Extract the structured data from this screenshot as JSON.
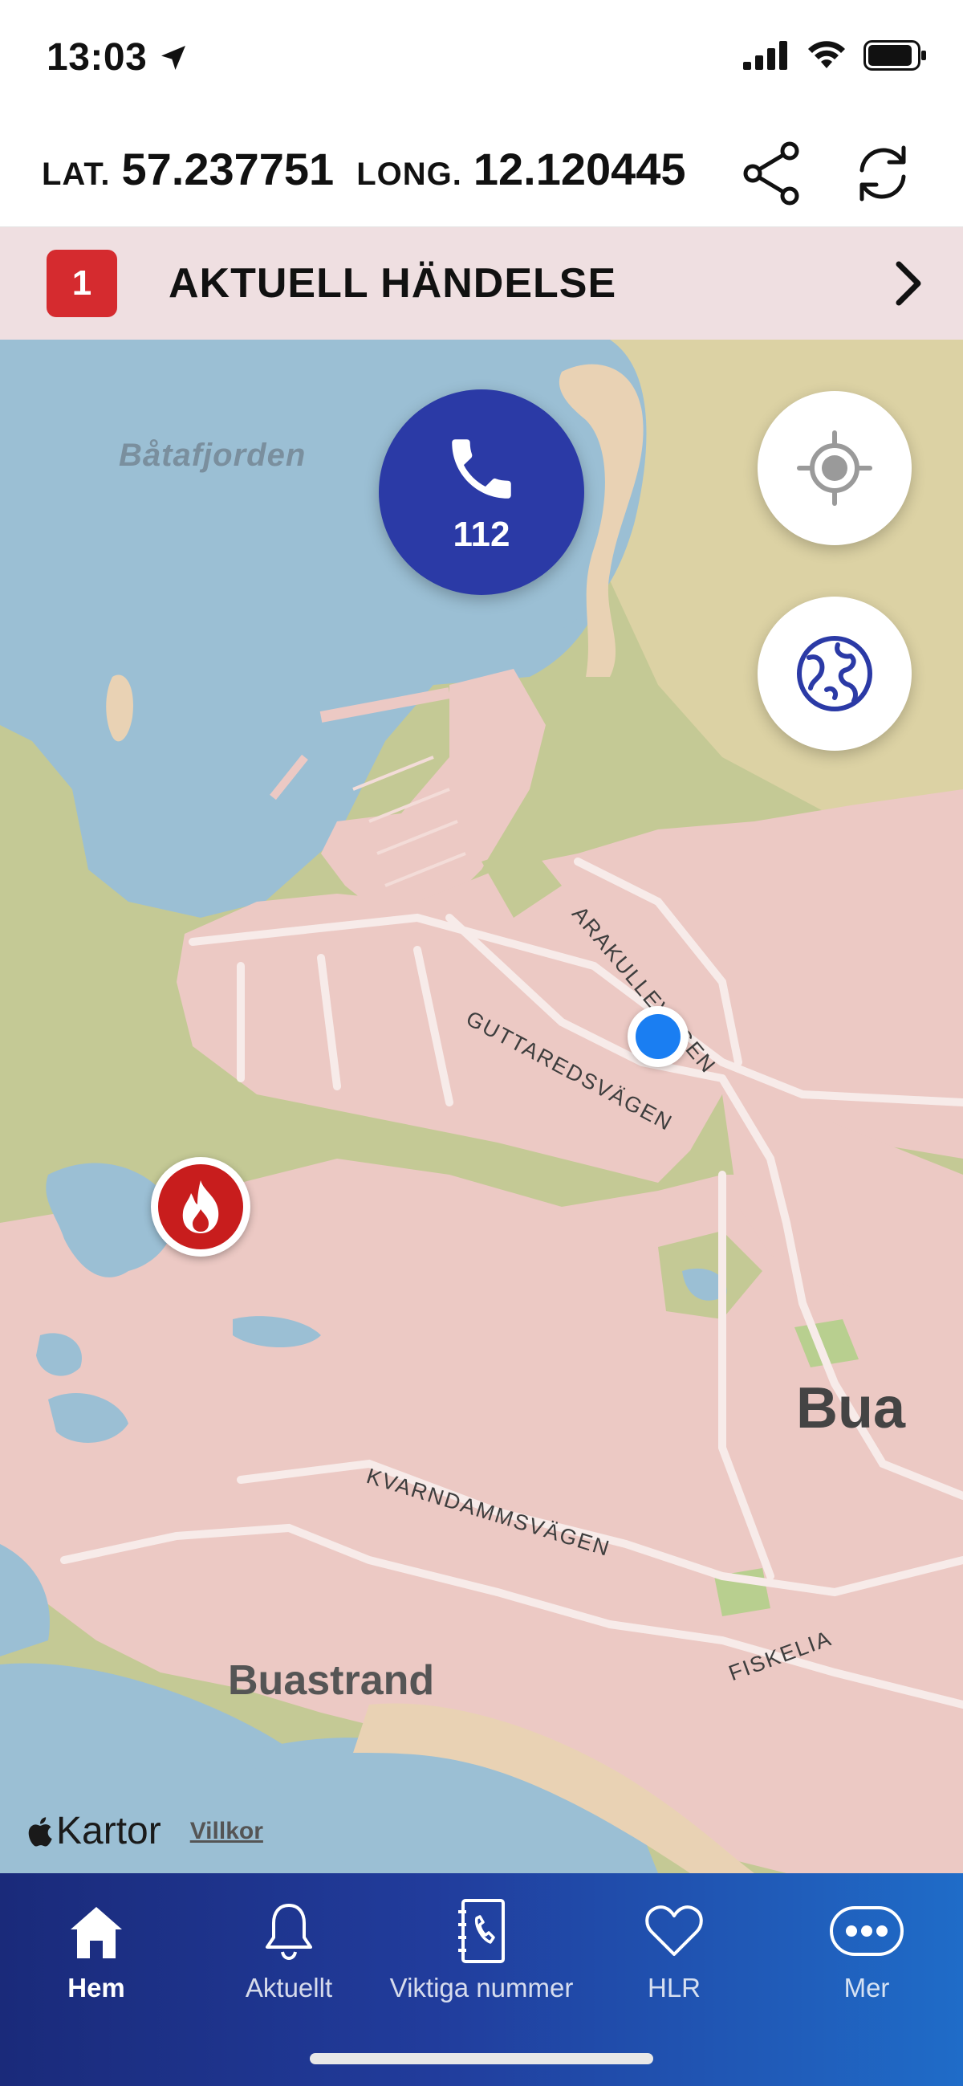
{
  "status_bar": {
    "time": "13:03"
  },
  "header": {
    "lat_label": "LAT.",
    "lat_value": "57.237751",
    "long_label": "LONG.",
    "long_value": "12.120445"
  },
  "incident": {
    "count": "1",
    "title": "AKTUELL HÄNDELSE"
  },
  "map": {
    "call_button_number": "112",
    "labels": {
      "water": "Båtafjorden",
      "road_arakulle": "ARAKULLEVÄGEN",
      "road_guttareds": "GUTTAREDSVÄGEN",
      "road_kvarndamms": "KVARNDAMMSVÄGEN",
      "road_fiskelia": "FISKELIA",
      "town_bua": "Bua",
      "place_buastrand": "Buastrand"
    },
    "attribution": {
      "provider": "Kartor",
      "terms_link": "Villkor"
    }
  },
  "tabs": [
    {
      "label": "Hem",
      "icon": "home-icon",
      "active": true
    },
    {
      "label": "Aktuellt",
      "icon": "bell-icon",
      "active": false
    },
    {
      "label": "Viktiga nummer",
      "icon": "phonebook-icon",
      "active": false
    },
    {
      "label": "HLR",
      "icon": "heart-icon",
      "active": false
    },
    {
      "label": "Mer",
      "icon": "more-icon",
      "active": false
    }
  ],
  "colors": {
    "brand_blue": "#2b3aa6",
    "incident_red": "#d52b2f",
    "incident_bg": "#efdfe1",
    "water": "#9bbfd4",
    "land_green": "#c4c995",
    "urban_pink": "#ecc9c4",
    "user_location": "#1a7ef2"
  }
}
